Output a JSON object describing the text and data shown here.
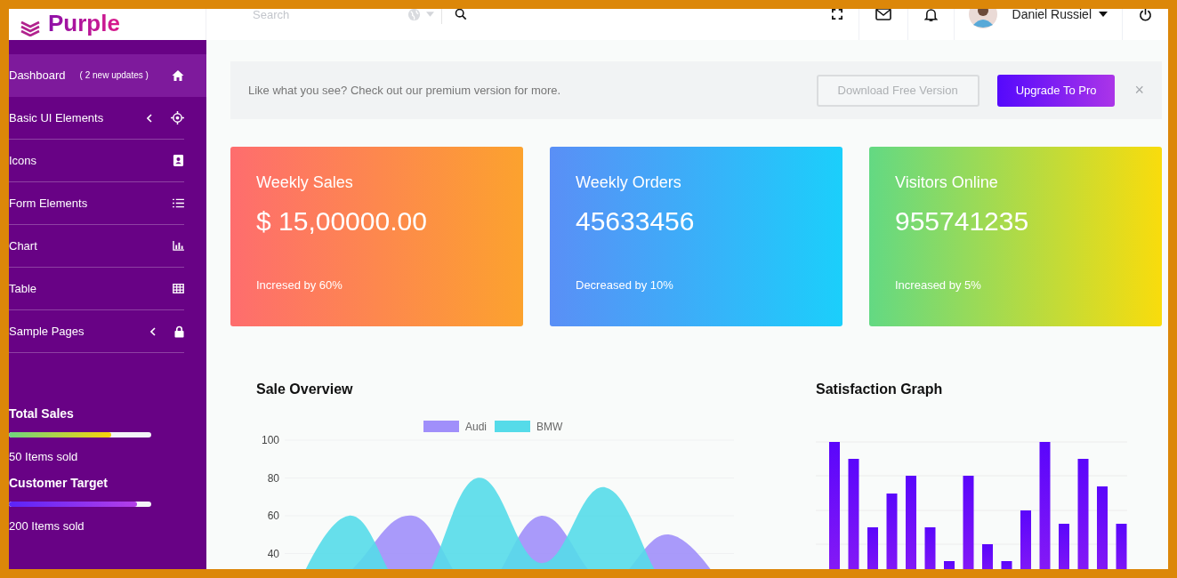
{
  "topbar": {
    "logo": "Purple",
    "search": {
      "placeholder": "Search"
    },
    "user": {
      "name": "Daniel Russiel"
    }
  },
  "sidebar": {
    "items": [
      {
        "label": "Dashboard",
        "badge": "( 2 new updates )",
        "selected": true,
        "expandable": false
      },
      {
        "label": "Basic UI Elements",
        "selected": false,
        "expandable": true
      },
      {
        "label": "Icons",
        "selected": false,
        "expandable": false
      },
      {
        "label": "Form Elements",
        "selected": false,
        "expandable": false
      },
      {
        "label": "Chart",
        "selected": false,
        "expandable": false
      },
      {
        "label": "Table",
        "selected": false,
        "expandable": false
      },
      {
        "label": "Sample Pages",
        "selected": false,
        "expandable": true
      }
    ],
    "stats": [
      {
        "kind": "sales",
        "title": "Total Sales",
        "level": 0.72,
        "caption": "50 Items sold"
      },
      {
        "kind": "target",
        "title": "Customer Target",
        "level": 0.9,
        "caption": "200 Items sold"
      }
    ]
  },
  "banner": {
    "text": "Like what you see? Check out our premium version for more.",
    "download_button": "Download Free Version",
    "upgrade_button": "Upgrade To Pro",
    "close": "×"
  },
  "cards": [
    {
      "kind": "sales",
      "title": "Weekly Sales",
      "value": "$ 15,00000.00",
      "footer": "Incresed by 60%"
    },
    {
      "kind": "orders",
      "title": "Weekly Orders",
      "value": "45633456",
      "footer": "Decreased by 10%"
    },
    {
      "kind": "visitors",
      "title": "Visitors Online",
      "value": "955741235",
      "footer": "Increased by 5%"
    }
  ],
  "sale_overview": {
    "title": "Sale Overview",
    "chart_data": {
      "type": "area",
      "legend": "top",
      "ylim": [
        0,
        100
      ],
      "yticks": [
        40,
        60,
        80,
        100
      ],
      "series": [
        {
          "name": "Audi",
          "color": "#a08ffa",
          "values": [
            0,
            30,
            60,
            20,
            60,
            25,
            50,
            15
          ]
        },
        {
          "name": "BMW",
          "color": "#55dbe9",
          "values": [
            10,
            60,
            20,
            80,
            35,
            75,
            20,
            10
          ]
        }
      ]
    }
  },
  "satisfaction": {
    "title": "Satisfaction Graph"
  }
}
